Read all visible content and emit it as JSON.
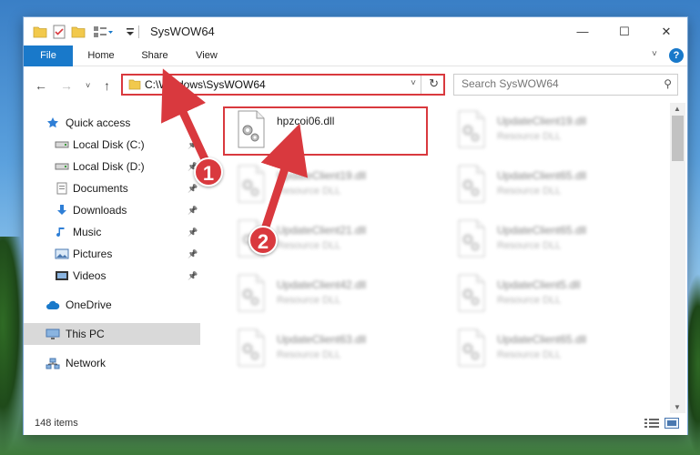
{
  "window": {
    "title": "SysWOW64",
    "controls": {
      "minimize": "—",
      "maximize": "☐",
      "close": "✕"
    }
  },
  "ribbon": {
    "tabs": [
      {
        "label": "File"
      },
      {
        "label": "Home"
      },
      {
        "label": "Share"
      },
      {
        "label": "View"
      }
    ],
    "help": "?"
  },
  "address": {
    "path": "C:\\Windows\\SysWOW64"
  },
  "search": {
    "placeholder": "Search SysWOW64"
  },
  "nav": {
    "items": [
      {
        "label": "Quick access",
        "icon": "star-icon"
      },
      {
        "label": "Local Disk (C:)",
        "icon": "drive-icon",
        "pinned": true
      },
      {
        "label": "Local Disk (D:)",
        "icon": "drive-icon",
        "pinned": true
      },
      {
        "label": "Documents",
        "icon": "documents-icon",
        "pinned": true
      },
      {
        "label": "Downloads",
        "icon": "download-icon",
        "pinned": true
      },
      {
        "label": "Music",
        "icon": "music-icon",
        "pinned": true
      },
      {
        "label": "Pictures",
        "icon": "pictures-icon",
        "pinned": true
      },
      {
        "label": "Videos",
        "icon": "videos-icon",
        "pinned": true
      },
      {
        "label": "OneDrive",
        "icon": "cloud-icon"
      },
      {
        "label": "This PC",
        "icon": "computer-icon",
        "selected": true
      },
      {
        "label": "Network",
        "icon": "network-icon"
      }
    ]
  },
  "files": [
    {
      "name": "hpzcoi06.dll",
      "type": ""
    },
    {
      "name": "UpdateClient19.dll",
      "type": "Resource DLL"
    },
    {
      "name": "UpdateClient19.dll",
      "type": "Resource DLL"
    },
    {
      "name": "UpdateClient65.dll",
      "type": "Resource DLL"
    },
    {
      "name": "UpdateClient21.dll",
      "type": "Resource DLL"
    },
    {
      "name": "UpdateClient65.dll",
      "type": "Resource DLL"
    },
    {
      "name": "UpdateClient42.dll",
      "type": "Resource DLL"
    },
    {
      "name": "UpdateClient5.dll",
      "type": "Resource DLL"
    },
    {
      "name": "UpdateClient63.dll",
      "type": "Resource DLL"
    },
    {
      "name": "UpdateClient65.dll",
      "type": "Resource DLL"
    }
  ],
  "status": {
    "item_count": "148 items"
  },
  "annotations": {
    "step1": "1",
    "step2": "2"
  },
  "colors": {
    "accent": "#1979ca",
    "annotation": "#d9393e",
    "folder": "#f2c94c"
  }
}
